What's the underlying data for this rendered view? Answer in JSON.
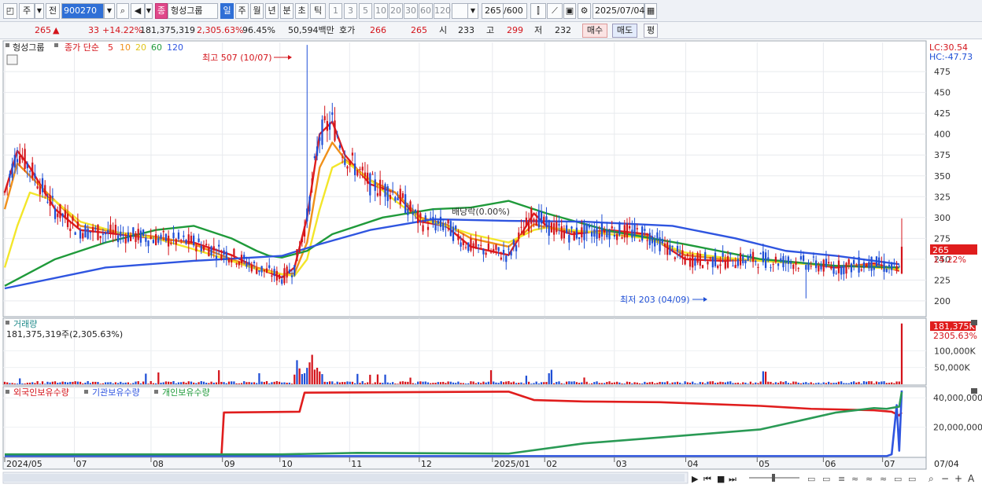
{
  "toolbar": {
    "period_label": "주",
    "prev_label": "전",
    "code": "900270",
    "stock_name": "헝성그룹",
    "stock_badge": "종",
    "tabs": [
      "일",
      "주",
      "월",
      "년",
      "분",
      "초",
      "틱"
    ],
    "intervals": [
      "1",
      "3",
      "5",
      "10",
      "20",
      "30",
      "60",
      "120"
    ],
    "count_value": "265",
    "count_total": "/600",
    "date": "2025/07/04"
  },
  "quote": {
    "price": "265",
    "change_arrow": "▲",
    "change": "33",
    "change_pct": "+14.22%",
    "volume": "181,375,319",
    "volume_ratio": "2,305.63%",
    "ratio2": "96.45%",
    "amount": "50,594백만",
    "hoga_label": "호가",
    "hoga_value1": "266",
    "hoga_value2": "265",
    "open_label": "시",
    "open": "233",
    "high_label": "고",
    "high": "299",
    "low_label": "저",
    "low": "232",
    "buy_label": "매수",
    "sell_label": "매도",
    "avg_label": "평"
  },
  "price_panel": {
    "legend_name": "헝성그룹",
    "legend_series": "종가 단순",
    "ma_labels": [
      "5",
      "10",
      "20",
      "60",
      "120"
    ],
    "lc_label": "LC:30.54",
    "hc_label": "HC:-47.73",
    "max_annotation": "최고 507 (10/07)",
    "min_annotation": "최저 203 (04/09)",
    "dividend_annotation": "배당락(0.00%)",
    "current_price_tag": "265",
    "current_pct_tag": "14.22%"
  },
  "volume_panel": {
    "title": "거래량",
    "value_text": "181,375,319주(2,305.63%)",
    "tag_value": "181,375K",
    "tag_pct": "2305.63%"
  },
  "holding_panel": {
    "legend": [
      "외국인보유수량",
      "기관보유수량",
      "개인보유수량"
    ]
  },
  "x_axis": {
    "labels": [
      "2024/05",
      "07",
      "08",
      "09",
      "10",
      "11",
      "12",
      "2025/01",
      "02",
      "03",
      "04",
      "05",
      "06",
      "07"
    ],
    "right_label": "07/04"
  },
  "colors": {
    "up": "#d4141b",
    "down": "#1f4fd6",
    "ma5": "#e01d1d",
    "ma10": "#f0901a",
    "ma20": "#f3e62a",
    "ma60": "#1f9a3a",
    "ma120": "#2f55e0",
    "foreign": "#e01d1d",
    "institution": "#2f55e0",
    "individual": "#2a9a55"
  },
  "chart_data": [
    {
      "type": "line",
      "title": "",
      "y_ticks": [
        200,
        225,
        250,
        275,
        300,
        325,
        350,
        375,
        400,
        425,
        450,
        475
      ],
      "ylim": [
        182,
        510
      ],
      "grid": true,
      "series": [
        {
          "name": "5",
          "x": [
            0,
            5,
            10,
            20,
            30,
            45,
            60,
            75,
            90,
            100,
            110,
            115,
            120,
            125,
            130,
            135,
            145,
            155,
            165,
            175,
            185,
            200,
            210,
            215,
            225,
            240,
            255,
            270,
            285,
            300,
            315,
            330,
            345,
            355
          ],
          "values": [
            330,
            380,
            360,
            310,
            285,
            280,
            275,
            270,
            255,
            240,
            228,
            240,
            300,
            400,
            415,
            375,
            340,
            330,
            295,
            290,
            265,
            255,
            305,
            290,
            280,
            285,
            280,
            250,
            248,
            250,
            246,
            240,
            245,
            236
          ]
        },
        {
          "name": "10",
          "x": [
            0,
            5,
            10,
            20,
            30,
            45,
            60,
            75,
            90,
            100,
            110,
            115,
            120,
            125,
            130,
            135,
            145,
            155,
            165,
            175,
            185,
            200,
            210,
            215,
            225,
            240,
            255,
            270,
            285,
            300,
            315,
            330,
            345,
            355
          ],
          "values": [
            310,
            365,
            350,
            320,
            290,
            282,
            277,
            268,
            250,
            240,
            232,
            233,
            270,
            360,
            390,
            370,
            345,
            330,
            300,
            292,
            275,
            265,
            292,
            288,
            283,
            283,
            278,
            255,
            250,
            248,
            245,
            242,
            243,
            238
          ]
        },
        {
          "name": "20",
          "x": [
            0,
            5,
            10,
            20,
            30,
            45,
            60,
            75,
            90,
            100,
            110,
            115,
            120,
            125,
            130,
            135,
            145,
            155,
            165,
            175,
            185,
            200,
            210,
            215,
            225,
            240,
            255,
            270,
            285,
            300,
            315,
            330,
            345,
            355
          ],
          "values": [
            240,
            290,
            330,
            320,
            295,
            282,
            275,
            262,
            248,
            238,
            232,
            230,
            250,
            310,
            360,
            368,
            345,
            320,
            298,
            290,
            280,
            270,
            285,
            288,
            285,
            280,
            275,
            258,
            252,
            248,
            245,
            242,
            240,
            238
          ]
        },
        {
          "name": "60",
          "x": [
            0,
            20,
            40,
            60,
            75,
            90,
            100,
            105,
            110,
            120,
            130,
            150,
            170,
            185,
            200,
            215,
            240,
            270,
            300,
            330,
            355
          ],
          "values": [
            218,
            250,
            270,
            285,
            290,
            275,
            260,
            254,
            252,
            260,
            280,
            300,
            310,
            312,
            320,
            305,
            284,
            268,
            250,
            242,
            240
          ]
        },
        {
          "name": "120",
          "x": [
            0,
            40,
            75,
            110,
            125,
            145,
            170,
            200,
            230,
            265,
            290,
            310,
            330,
            355
          ],
          "values": [
            215,
            240,
            248,
            254,
            268,
            285,
            298,
            296,
            295,
            290,
            275,
            260,
            254,
            244
          ]
        }
      ]
    },
    {
      "type": "bar",
      "title": "거래량",
      "y_ticks": [
        50000,
        100000
      ],
      "y_tick_labels": [
        "50,000K",
        "100,000K"
      ],
      "ylim": [
        0,
        190000
      ],
      "last_value": 181375
    },
    {
      "type": "line",
      "title": "",
      "y_ticks": [
        20000000,
        40000000
      ],
      "y_tick_labels": [
        "20,000,000",
        "40,000,000"
      ],
      "ylim": [
        0,
        46000000
      ],
      "series": [
        {
          "name": "외국인보유수량",
          "x": [
            0,
            75,
            86,
            87,
            117,
            119,
            200,
            210,
            230,
            260,
            300,
            320,
            345,
            352,
            355,
            356
          ],
          "values": [
            500000,
            500000,
            500000,
            30000000,
            30500000,
            43500000,
            44200000,
            38500000,
            37500000,
            37000000,
            34500000,
            32500000,
            31500000,
            30500000,
            28000000,
            30000000
          ]
        },
        {
          "name": "기관보유수량",
          "x": [
            0,
            350,
            352,
            354,
            355,
            356
          ],
          "values": [
            300000,
            300000,
            1500000,
            35000000,
            4000000,
            45000000
          ]
        },
        {
          "name": "개인보유수량",
          "x": [
            0,
            110,
            140,
            200,
            230,
            260,
            300,
            330,
            345,
            350,
            355,
            356
          ],
          "values": [
            1500000,
            1500000,
            2500000,
            2000000,
            9000000,
            13000000,
            18500000,
            30000000,
            33000000,
            32500000,
            34000000,
            44000000
          ]
        }
      ]
    }
  ]
}
